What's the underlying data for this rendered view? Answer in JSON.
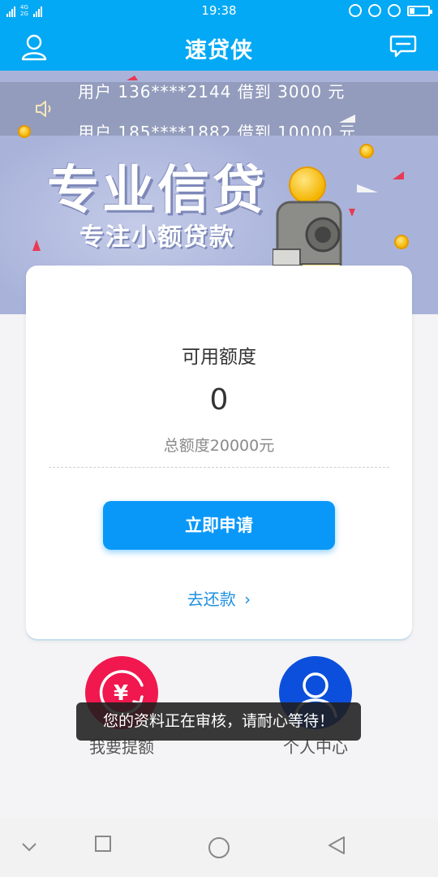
{
  "status_bar": {
    "time": "19:38",
    "net_top": "2G",
    "net_mid": "4G",
    "net_bot": "2G"
  },
  "header": {
    "title": "速贷侠",
    "left_icon": "user-icon",
    "right_icon": "message-icon",
    "background": "#03a9f4"
  },
  "banner": {
    "notice_lines": [
      "用户 136****2144 借到 3000 元",
      "用户 185****1882 借到 10000 元"
    ],
    "title": "专业信贷",
    "subtitle": "专注小额贷款"
  },
  "card": {
    "available_label": "可用额度",
    "available_value": "0",
    "total_text": "总额度20000元",
    "apply_label": "立即申请",
    "repay_label": "去还款",
    "repay_chevron": "›"
  },
  "actions": [
    {
      "label": "我要提额",
      "icon": "yuan-icon",
      "color": "#f0184e"
    },
    {
      "label": "个人中心",
      "icon": "person-icon",
      "color": "#0c4fdc"
    }
  ],
  "toast": {
    "text": "您的资料正在审核，请耐心等待！"
  },
  "navbar": {
    "items": [
      "chevron-down-icon",
      "square-icon",
      "circle-icon",
      "back-triangle-icon"
    ]
  }
}
